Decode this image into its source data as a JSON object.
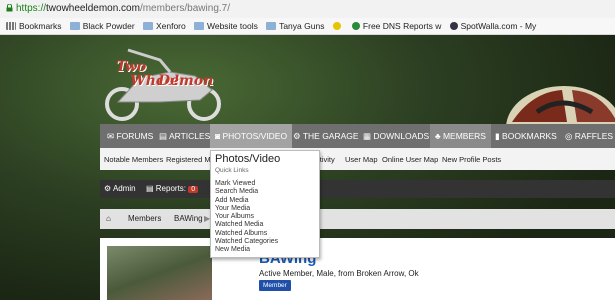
{
  "browser": {
    "url_scheme": "https://",
    "url_host": "twowheeldemon.com",
    "url_path": "/members/bawing.7/"
  },
  "bookmarks_bar": {
    "items": [
      {
        "label": "Bookmarks",
        "icon": "apps-grid-icon"
      },
      {
        "label": "Black Powder",
        "icon": "folder-icon"
      },
      {
        "label": "Xenforo",
        "icon": "folder-icon"
      },
      {
        "label": "Website tools",
        "icon": "folder-icon"
      },
      {
        "label": "Tanya Guns",
        "icon": "folder-icon"
      },
      {
        "label": "Free DNS Reports w",
        "icon": "dns-icon"
      },
      {
        "label": "SpotWalla.com - My",
        "icon": "spotwalla-icon"
      }
    ]
  },
  "site": {
    "logo_line1": "Two",
    "logo_line2": "Wheel",
    "logo_line3": "Demon"
  },
  "nav": {
    "items": [
      {
        "label": "FORUMS",
        "icon": "comments-icon"
      },
      {
        "label": "ARTICLES",
        "icon": "newspaper-icon"
      },
      {
        "label": "PHOTOS/VIDEO",
        "icon": "camera-icon"
      },
      {
        "label": "THE GARAGE",
        "icon": "motorcycle-icon"
      },
      {
        "label": "DOWNLOADS",
        "icon": "film-icon"
      },
      {
        "label": "MEMBERS",
        "icon": "paw-icon"
      },
      {
        "label": "BOOKMARKS",
        "icon": "bookmark-icon"
      },
      {
        "label": "RAFFLES",
        "icon": "life-ring-icon"
      }
    ]
  },
  "subnav": {
    "items": [
      "Notable Members",
      "Registered Me",
      "ctivity",
      "User Map",
      "Online User Map",
      "New Profile Posts"
    ]
  },
  "admin_bar": {
    "admin_label": "Admin",
    "reports_label": "Reports:",
    "reports_count": "0"
  },
  "breadcrumb": {
    "items": [
      "Members",
      "BAWing"
    ]
  },
  "profile": {
    "name": "BAWing",
    "info": "Active Member, Male, from Broken Arrow, Ok",
    "badge": "Member"
  },
  "dropdown": {
    "title": "Photos/Video",
    "subtitle": "Quick Links",
    "items": [
      "Mark Viewed",
      "Search Media",
      "Add Media",
      "Your Media",
      "Your Albums",
      "Watched Media",
      "Watched Albums",
      "Watched Categories",
      "New Media"
    ]
  },
  "colors": {
    "nav_bg": "#6f6f6f",
    "nav_active": "#a3a3a3",
    "profile_name": "#1b5bb5",
    "url_scheme": "#1a7f1a",
    "reports_badge": "#c0392b"
  }
}
